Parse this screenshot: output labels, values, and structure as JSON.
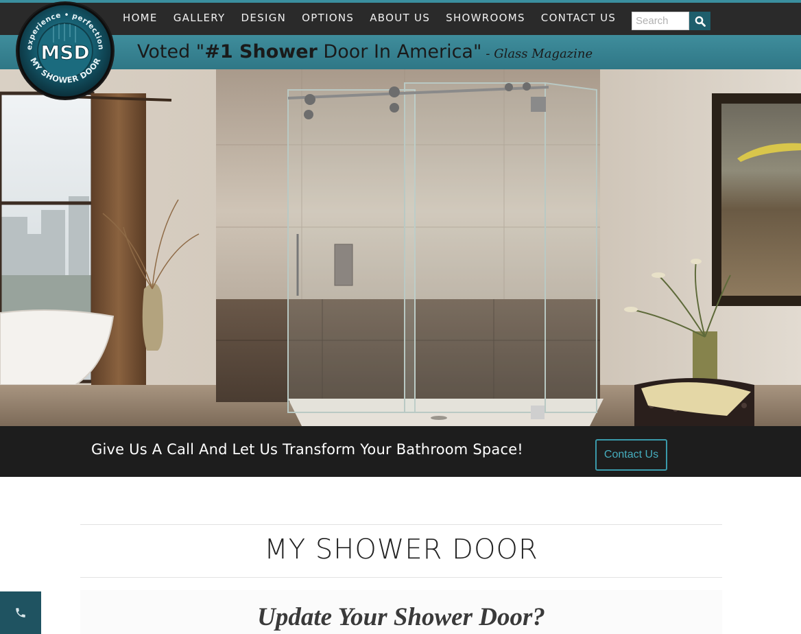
{
  "nav": {
    "items": [
      {
        "label": "HOME"
      },
      {
        "label": "GALLERY"
      },
      {
        "label": "DESIGN"
      },
      {
        "label": "OPTIONS"
      },
      {
        "label": "ABOUT US"
      },
      {
        "label": "SHOWROOMS"
      },
      {
        "label": "CONTACT US"
      }
    ],
    "search_placeholder": "Search",
    "search_icon": "search-icon"
  },
  "logo": {
    "text": "MSD",
    "ring_top": "experience • perfection",
    "ring_bottom": "MY SHOWER DOOR"
  },
  "tagline": {
    "prefix": "Voted \"",
    "highlight": "#1 Shower",
    "suffix": " Door In America\"",
    "source": "- Glass Magazine"
  },
  "call_band": {
    "text": "Give Us A Call And Let Us Transform Your Bathroom Space!",
    "button_label": "Contact Us"
  },
  "main": {
    "title": "MY SHOWER DOOR",
    "subtitle": "Update Your Shower Door?"
  },
  "phone_tab": {
    "icon": "phone-icon"
  },
  "colors": {
    "accent": "#3a8f9f",
    "nav_bg": "#2a2a2a",
    "call_bg": "#1d1d1d",
    "button_border": "#3a9aab",
    "phone_tab": "#1f5361"
  }
}
